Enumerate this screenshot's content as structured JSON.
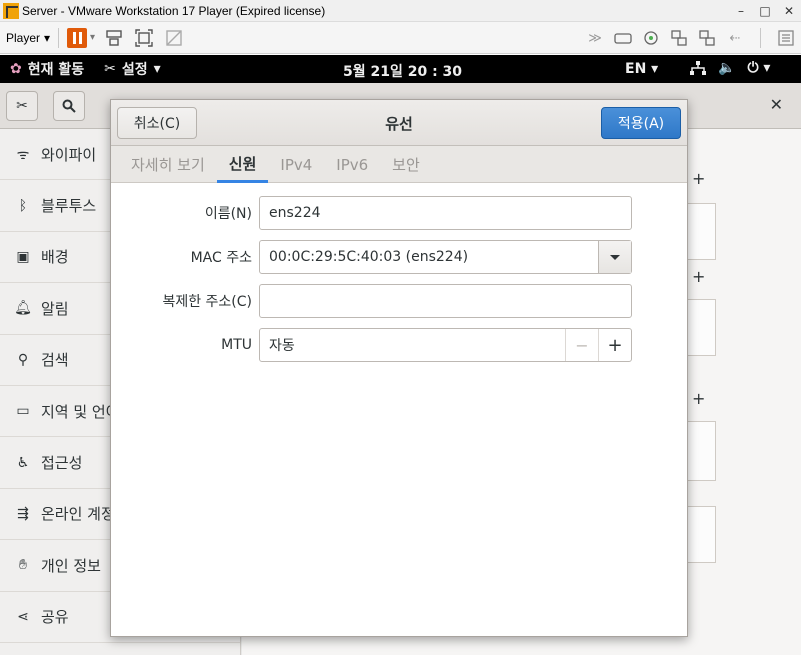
{
  "vmware": {
    "title": "Server - VMware Workstation 17 Player (Expired license)",
    "window_buttons": [
      "–",
      "□",
      "✕"
    ],
    "player_menu": "Player"
  },
  "gnome": {
    "activities": "현재 활동",
    "app_menu": "설정",
    "clock": "5월 21일  20 : 30",
    "language": "EN"
  },
  "settings": {
    "sidebar": [
      {
        "label": "와이파이",
        "icon": "wifi-icon"
      },
      {
        "label": "블루투스",
        "icon": "bluetooth-icon"
      },
      {
        "label": "배경",
        "icon": "background-icon"
      },
      {
        "label": "알림",
        "icon": "bell-icon"
      },
      {
        "label": "검색",
        "icon": "search-icon"
      },
      {
        "label": "지역 및 언어",
        "icon": "camera-icon"
      },
      {
        "label": "접근성",
        "icon": "accessibility-icon"
      },
      {
        "label": "온라인 계정",
        "icon": "online-accounts-icon"
      },
      {
        "label": "개인 정보",
        "icon": "hand-icon"
      },
      {
        "label": "공유",
        "icon": "share-icon"
      }
    ],
    "close_glyph": "✕",
    "plus_glyph": "+"
  },
  "dialog": {
    "title": "유선",
    "cancel_label": "취소(C)",
    "apply_label": "적용(A)",
    "tabs": [
      "자세히 보기",
      "신원",
      "IPv4",
      "IPv6",
      "보안"
    ],
    "active_tab": "신원",
    "fields": {
      "name_label": "이름(N)",
      "name_value": "ens224",
      "mac_label": "MAC 주소",
      "mac_value": "00:0C:29:5C:40:03 (ens224)",
      "clone_label": "복제한 주소(C)",
      "clone_value": "",
      "mtu_label": "MTU",
      "mtu_value": "자동",
      "mtu_minus": "−",
      "mtu_plus": "+"
    }
  },
  "colors": {
    "accent": "#3584e4",
    "apply_button": "#2f78c8",
    "vm_pause": "#e05a0a"
  }
}
